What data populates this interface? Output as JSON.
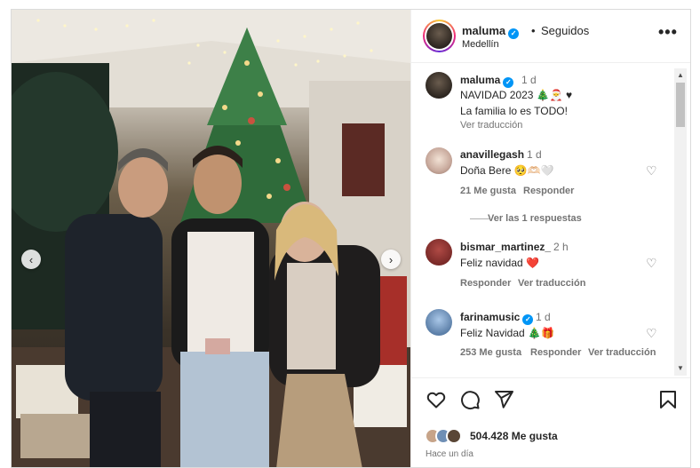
{
  "header": {
    "username": "maluma",
    "dot": "•",
    "follow_status": "Seguidos",
    "location": "Medellín",
    "more": "•••"
  },
  "caption": {
    "username": "maluma",
    "time": "1 d",
    "line1": "NAVIDAD 2023 🎄🎅 ♥",
    "line2": "La familia lo es TODO!",
    "translate": "Ver traducción"
  },
  "comments": [
    {
      "username": "anavillegash",
      "time": "1 d",
      "text": "Doña Bere 🥺🫶🏻🤍",
      "likes": "21 Me gusta",
      "reply": "Responder",
      "view_replies": "Ver las 1 respuestas"
    },
    {
      "username": "bismar_martinez_",
      "time": "2 h",
      "text": "Feliz navidad ❤️",
      "reply": "Responder",
      "translate": "Ver traducción"
    },
    {
      "username": "farinamusic",
      "time": "1 d",
      "text": "Feliz Navidad 🎄🎁",
      "likes": "253 Me gusta",
      "reply": "Responder",
      "translate": "Ver traducción"
    }
  ],
  "footer": {
    "likes": "504.428 Me gusta",
    "posted": "Hace un día"
  },
  "icons": {
    "like": "heart-icon",
    "comment": "comment-icon",
    "share": "share-icon",
    "save": "bookmark-icon",
    "prev": "chevron-left-icon",
    "next": "chevron-right-icon"
  },
  "colors": {
    "verified": "#0095f6",
    "muted": "#737373",
    "text": "#262626"
  }
}
